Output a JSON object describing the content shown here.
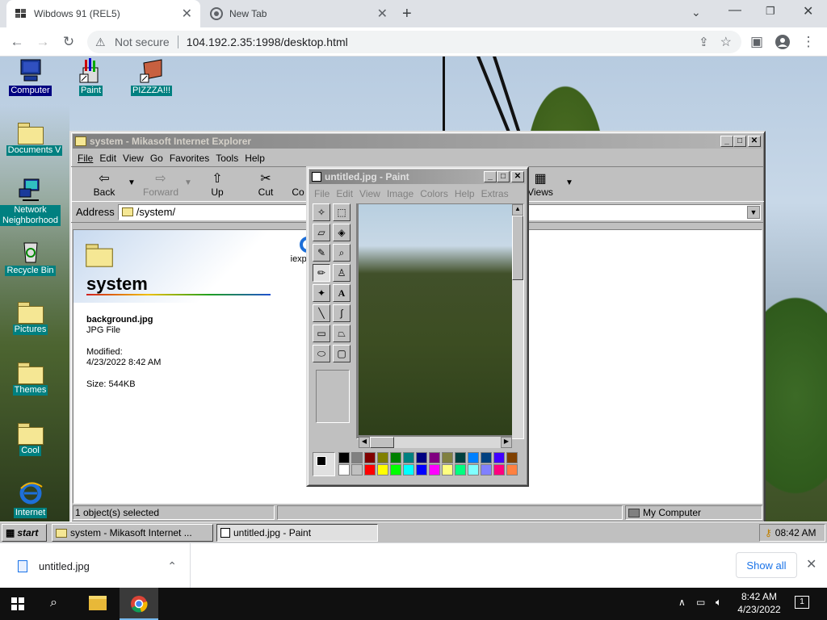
{
  "browser": {
    "tabs": [
      {
        "title": "Wibdows 91 (REL5)",
        "active": true
      },
      {
        "title": "New Tab",
        "active": false
      }
    ],
    "address": {
      "security": "Not secure",
      "url": "104.192.2.35:1998/desktop.html"
    }
  },
  "desktop": {
    "icons": [
      {
        "label": "Computer"
      },
      {
        "label": "Paint"
      },
      {
        "label": "PIZZZA!!!"
      },
      {
        "label": "Documents"
      },
      {
        "label": "V"
      },
      {
        "label": "Network Neighborhood"
      },
      {
        "label": "Recycle Bin"
      },
      {
        "label": "Pictures"
      },
      {
        "label": "Themes"
      },
      {
        "label": "Cool"
      },
      {
        "label": "Internet"
      }
    ]
  },
  "explorer": {
    "title": "system - Mikasoft Internet Explorer",
    "menu": [
      "File",
      "Edit",
      "View",
      "Go",
      "Favorites",
      "Tools",
      "Help"
    ],
    "toolbar": {
      "back": "Back",
      "forward": "Forward",
      "up": "Up",
      "cut": "Cut",
      "copy": "Co",
      "views": "Views"
    },
    "address_label": "Address",
    "address_value": "/system/",
    "folder_name": "system",
    "file_name": "background.jpg",
    "file_type": "JPG File",
    "modified_label": "Modified:",
    "modified_value": "4/23/2022 8:42 AM",
    "size": "Size: 544KB",
    "partial_icon_label": "iexplo",
    "status_left": "1 object(s) selected",
    "status_right": "My Computer"
  },
  "paint": {
    "title": "untitled.jpg - Paint",
    "menu": [
      "File",
      "Edit",
      "View",
      "Image",
      "Colors",
      "Help",
      "Extras"
    ],
    "palette_top": [
      "#000000",
      "#808080",
      "#800000",
      "#808000",
      "#008000",
      "#008080",
      "#000080",
      "#800080",
      "#808040",
      "#004040",
      "#0080ff",
      "#004080",
      "#4000ff",
      "#804000"
    ],
    "palette_bottom": [
      "#ffffff",
      "#c0c0c0",
      "#ff0000",
      "#ffff00",
      "#00ff00",
      "#00ffff",
      "#0000ff",
      "#ff00ff",
      "#ffff80",
      "#00ff80",
      "#80ffff",
      "#8080ff",
      "#ff0080",
      "#ff8040"
    ]
  },
  "taskbar98": {
    "start": "start",
    "items": [
      "system - Mikasoft Internet ...",
      "untitled.jpg - Paint"
    ],
    "clock": "08:42 AM"
  },
  "downloads": {
    "file": "untitled.jpg",
    "show_all": "Show all"
  },
  "win10": {
    "time": "8:42 AM",
    "date": "4/23/2022",
    "notifications": "1"
  }
}
